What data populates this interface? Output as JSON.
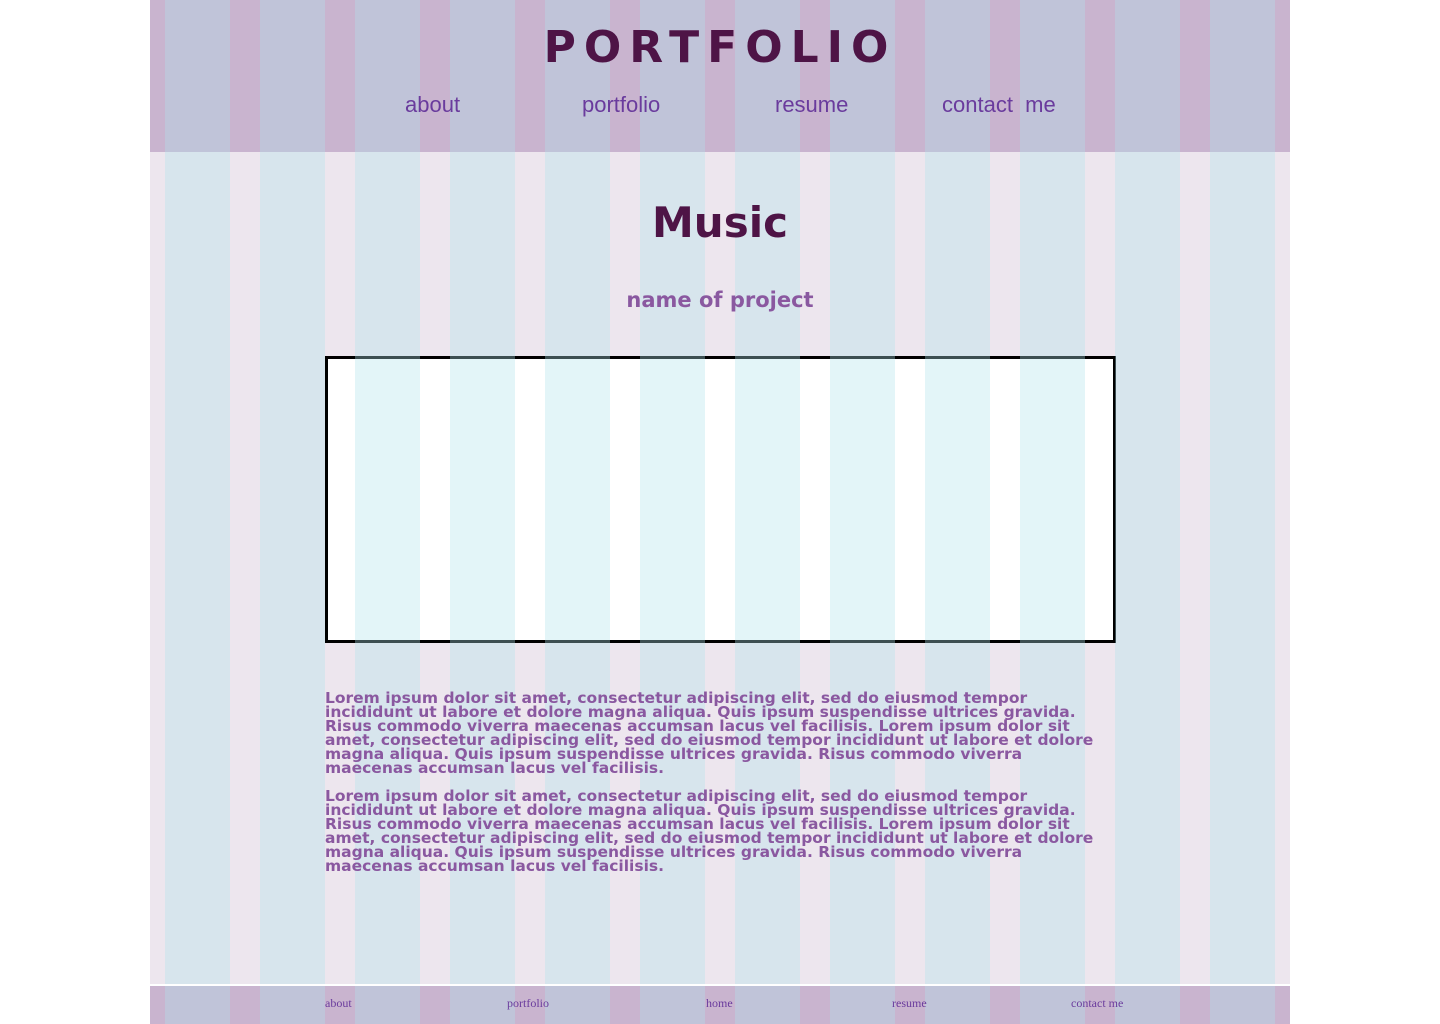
{
  "header": {
    "title": "PORTFOLIO",
    "nav": [
      "about",
      "portfolio",
      "resume",
      "contact  me"
    ]
  },
  "main": {
    "section_title": "Music",
    "project_name": "name of project",
    "paragraphs": [
      "Lorem ipsum dolor sit amet, consectetur adipiscing elit, sed do eiusmod tempor incididunt ut labore et dolore magna aliqua. Quis ipsum suspendisse ultrices gravida. Risus commodo viverra maecenas accumsan lacus vel facilisis. Lorem ipsum dolor sit amet, consectetur adipiscing elit, sed do eiusmod tempor incididunt ut labore et dolore magna aliqua. Quis ipsum suspendisse ultrices gravida. Risus commodo viverra maecenas accumsan lacus vel facilisis.",
      "Lorem ipsum dolor sit amet, consectetur adipiscing elit, sed do eiusmod tempor incididunt ut labore et dolore magna aliqua. Quis ipsum suspendisse ultrices gravida. Risus commodo viverra maecenas accumsan lacus vel facilisis. Lorem ipsum dolor sit amet, consectetur adipiscing elit, sed do eiusmod tempor incididunt ut labore et dolore magna aliqua. Quis ipsum suspendisse ultrices gravida. Risus commodo viverra maecenas accumsan lacus vel facilisis."
    ]
  },
  "footer": {
    "nav": [
      "about",
      "portfolio",
      "home",
      "resume",
      "contact me"
    ]
  },
  "colors": {
    "title": "#4e1446",
    "nav_link": "#6a3b9d",
    "body_text": "#8a58a0",
    "header_bg": "#c9b4cf",
    "page_bg": "#ede6ee",
    "grid_overlay": "#afe1eb"
  }
}
